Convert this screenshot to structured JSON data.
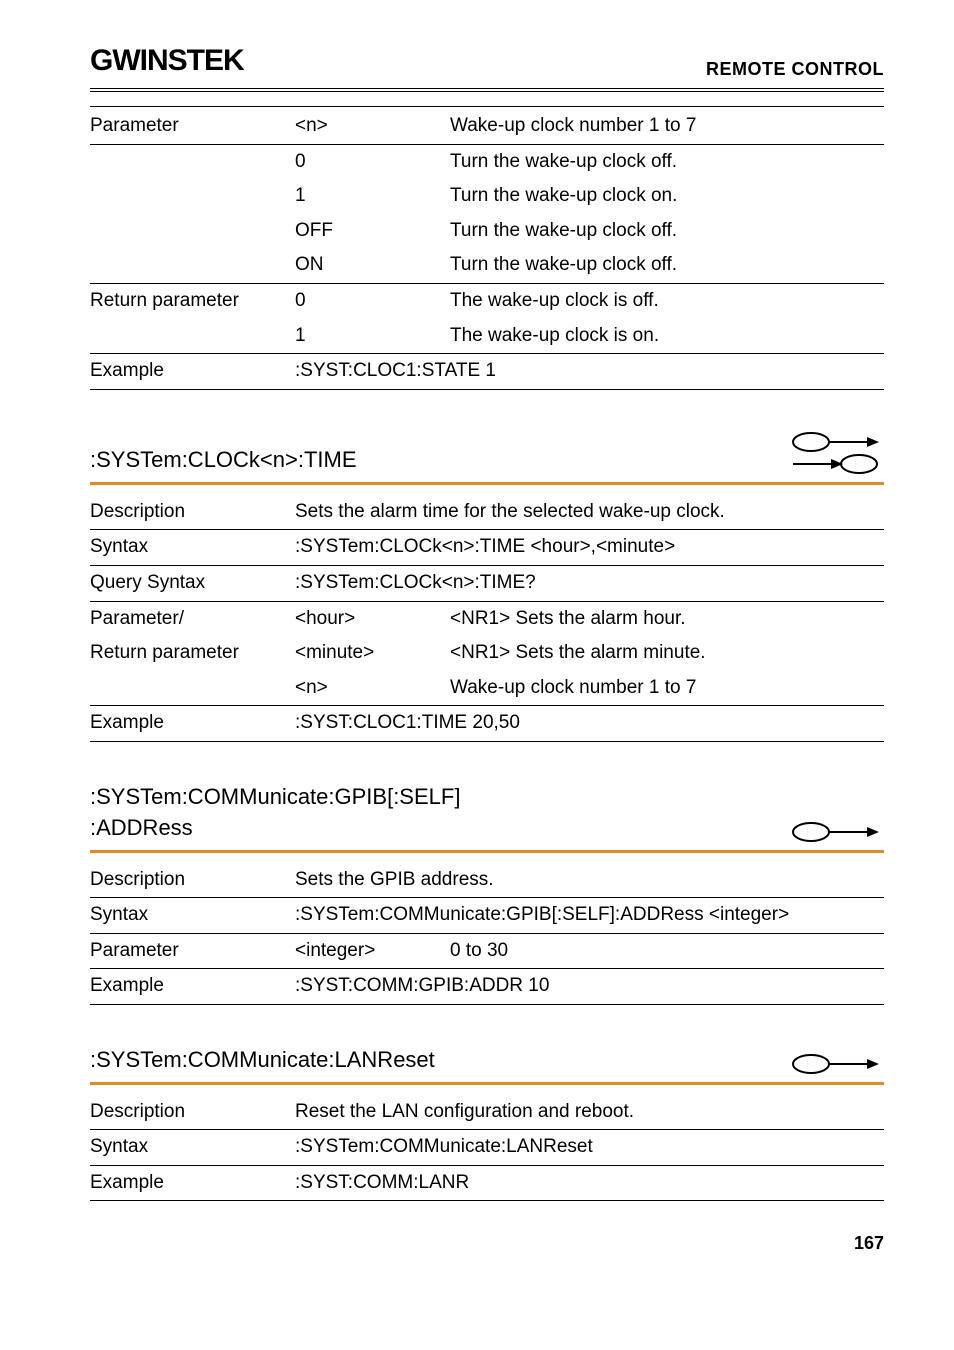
{
  "header": {
    "logo": "GWINSTEK",
    "title": "REMOTE CONTROL"
  },
  "block1": {
    "rows": [
      {
        "label": "Parameter",
        "mid": "<n>",
        "desc": "Wake-up clock number 1 to 7"
      },
      {
        "label": "",
        "mid": "0",
        "desc": "Turn the wake-up clock off."
      },
      {
        "label": "",
        "mid": "1",
        "desc": "Turn the wake-up clock on."
      },
      {
        "label": "",
        "mid": "OFF",
        "desc": "Turn the wake-up clock off."
      },
      {
        "label": "",
        "mid": "ON",
        "desc": "Turn the wake-up clock off."
      },
      {
        "label": "Return parameter",
        "mid": "0",
        "desc": "The wake-up clock is off."
      },
      {
        "label": "",
        "mid": "1",
        "desc": "The wake-up clock is on."
      },
      {
        "label": "Example",
        "example": ":SYST:CLOC1:STATE 1"
      }
    ]
  },
  "section1": {
    "heading": ":SYSTem:CLOCk<n>:TIME",
    "rows": [
      {
        "label": "Description",
        "value": "Sets the alarm time for the selected wake-up clock."
      },
      {
        "label": "Syntax",
        "value": ":SYSTem:CLOCk<n>:TIME <hour>,<minute>"
      },
      {
        "label": "Query Syntax",
        "value": ":SYSTem:CLOCk<n>:TIME?"
      },
      {
        "label": "Parameter/",
        "mid": "<hour>",
        "desc": "<NR1> Sets the alarm hour."
      },
      {
        "label": "Return parameter",
        "mid": "<minute>",
        "desc": "<NR1> Sets the alarm minute."
      },
      {
        "label": "",
        "mid": "<n>",
        "desc": "Wake-up clock number 1 to 7"
      },
      {
        "label": "Example",
        "example": ":SYST:CLOC1:TIME 20,50"
      }
    ]
  },
  "section2": {
    "heading1": ":SYSTem:COMMunicate:GPIB[:SELF]",
    "heading2": ":ADDRess",
    "rows": [
      {
        "label": "Description",
        "value": "Sets the GPIB address."
      },
      {
        "label": "Syntax",
        "value": ":SYSTem:COMMunicate:GPIB[:SELF]:ADDRess <integer>"
      },
      {
        "label": "Parameter",
        "mid": "<integer>",
        "desc": "0 to 30"
      },
      {
        "label": "Example",
        "example": ":SYST:COMM:GPIB:ADDR 10"
      }
    ]
  },
  "section3": {
    "heading": ":SYSTem:COMMunicate:LANReset",
    "rows": [
      {
        "label": "Description",
        "value": "Reset the LAN configuration and reboot."
      },
      {
        "label": "Syntax",
        "value": ":SYSTem:COMMunicate:LANReset"
      },
      {
        "label": "Example",
        "example": ":SYST:COMM:LANR"
      }
    ]
  },
  "pagenum": "167",
  "chart_data": null
}
